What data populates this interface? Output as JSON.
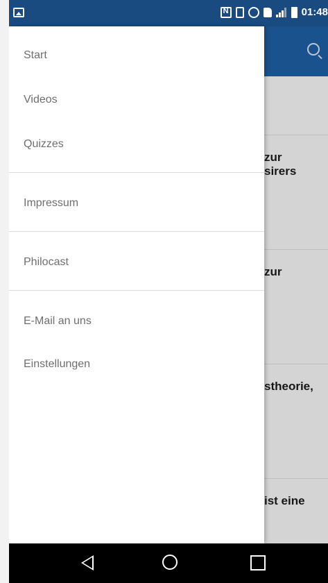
{
  "status_bar": {
    "time": "01:48",
    "icons": [
      "gallery-icon",
      "nfc-icon",
      "vibrate-icon",
      "alarm-icon",
      "sim-icon",
      "signal-icon",
      "battery-icon"
    ]
  },
  "app_bar": {
    "search_icon": "search-icon",
    "color": "#1c5a99"
  },
  "feed": {
    "cards": [
      {
        "text": "zur\nsirers"
      },
      {
        "text": "zur"
      },
      {
        "text": "stheorie,"
      },
      {
        "text": "ist eine"
      }
    ]
  },
  "drawer": {
    "items": [
      {
        "label": "Start"
      },
      {
        "label": "Videos"
      },
      {
        "label": "Quizzes"
      },
      {
        "label": "Impressum"
      },
      {
        "label": "Philocast"
      },
      {
        "label": "E-Mail an uns"
      },
      {
        "label": "Einstellungen"
      }
    ]
  },
  "nav_bar": {
    "icons": [
      "back-icon",
      "home-icon",
      "recent-apps-icon"
    ]
  }
}
